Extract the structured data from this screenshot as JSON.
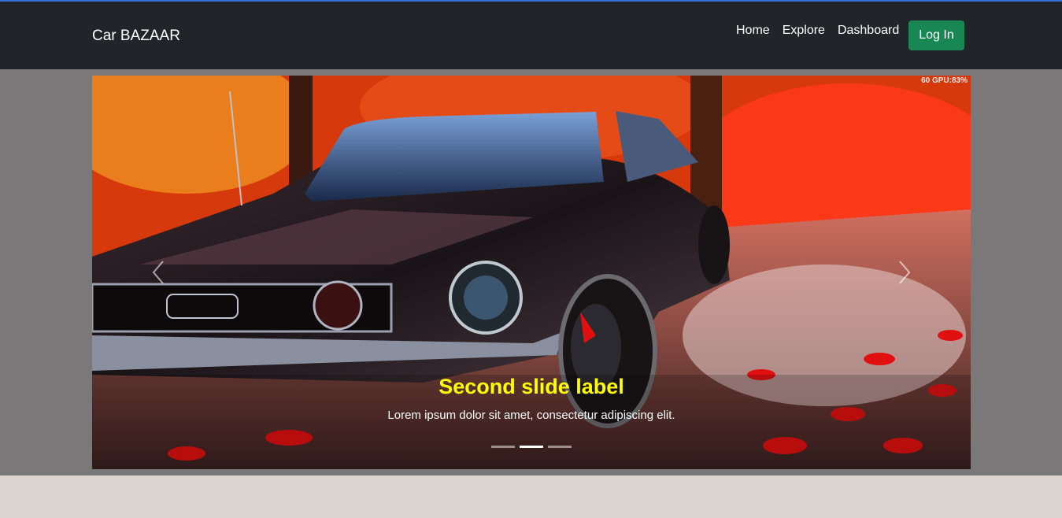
{
  "navbar": {
    "brand": "Car BAZAAR",
    "links": [
      "Home",
      "Explore",
      "Dashboard"
    ],
    "login_label": "Log In",
    "login_color": "#198754",
    "background": "#212529"
  },
  "carousel": {
    "overlay_text": "60 GPU:83%",
    "active_slide": 2,
    "slide_count": 3,
    "caption_title": "Second slide label",
    "caption_text": "Lorem ipsum dolor sit amet, consectetur adipiscing elit.",
    "caption_title_color": "#ffff00",
    "prev_icon": "chevron-left-icon",
    "next_icon": "chevron-right-icon"
  }
}
